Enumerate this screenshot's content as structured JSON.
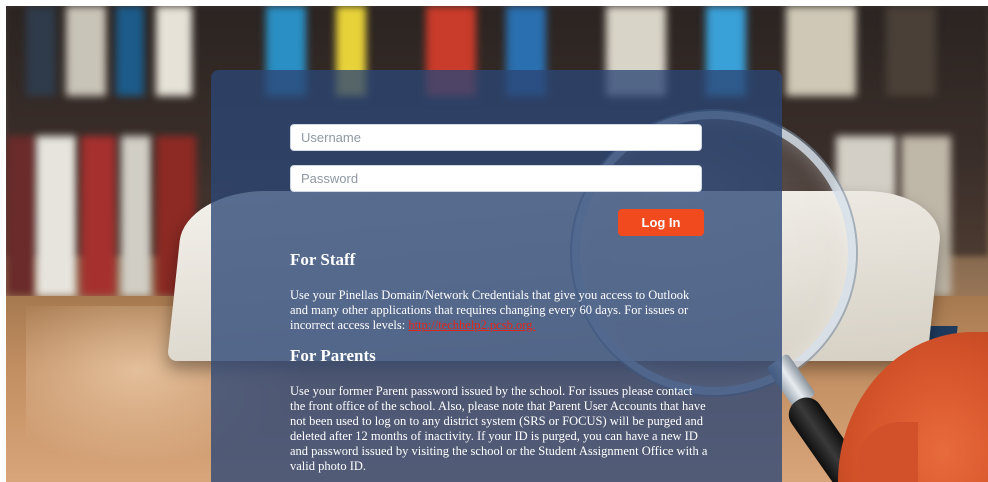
{
  "login": {
    "username_placeholder": "Username",
    "password_placeholder": "Password",
    "login_button": "Log In"
  },
  "staff": {
    "heading": "For Staff",
    "text": "Use your Pinellas Domain/Network Credentials that give you access to Outlook and many other applications that requires changing every 60 days. For issues or incorrect access levels: ",
    "link_text": "http://techhelp2.pcsb.org."
  },
  "parents": {
    "heading": "For Parents",
    "text": "Use your former Parent password issued by the school. For issues please contact the front office of the school. Also, please note that Parent User Accounts that have not been used to log on to any district system (SRS or FOCUS) will be purged and deleted after 12 months of inactivity. If your ID is purged, you can have a new ID and password issued by visiting the school or the Student Assignment Office with a valid photo ID."
  },
  "colors": {
    "panel": "#2c4676",
    "button": "#f04a1e",
    "link": "#e0261b"
  }
}
